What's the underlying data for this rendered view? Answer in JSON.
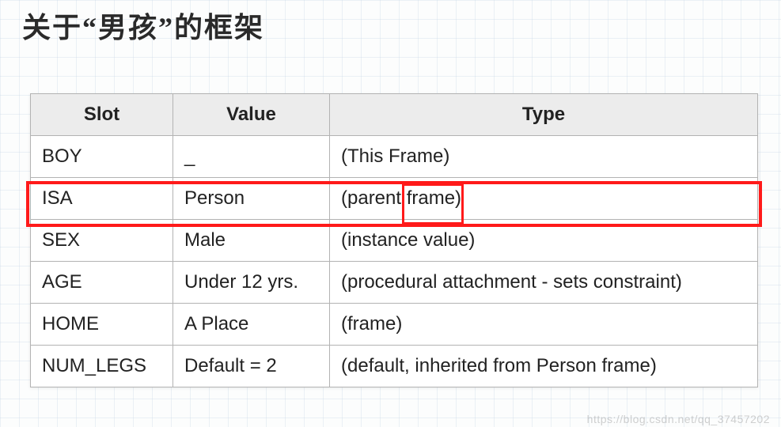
{
  "title": "关于“男孩”的框架",
  "columns": {
    "slot": "Slot",
    "value": "Value",
    "type": "Type"
  },
  "rows": [
    {
      "slot": "BOY",
      "value": "_",
      "type": "(This Frame)"
    },
    {
      "slot": "ISA",
      "value": "Person",
      "type": "(parent frame)"
    },
    {
      "slot": "SEX",
      "value": "Male",
      "type": "(instance value)"
    },
    {
      "slot": "AGE",
      "value": "Under 12 yrs.",
      "type": "(procedural attachment - sets constraint)"
    },
    {
      "slot": "HOME",
      "value": "A Place",
      "type": "(frame)"
    },
    {
      "slot": "NUM_LEGS",
      "value": "Default = 2",
      "type": "(default, inherited from Person frame)"
    }
  ],
  "highlight": {
    "row_index": 1,
    "word_in_type": "frame"
  },
  "watermark": "https://blog.csdn.net/qq_37457202"
}
